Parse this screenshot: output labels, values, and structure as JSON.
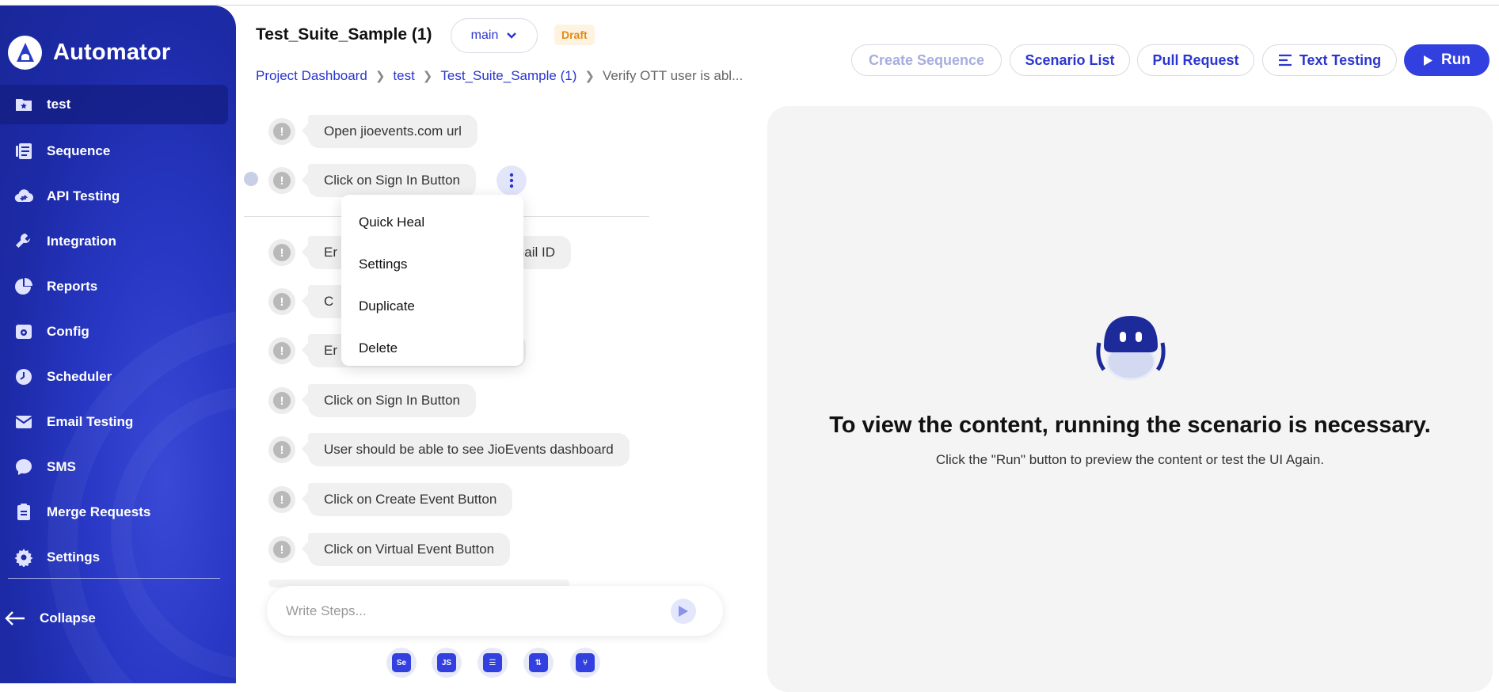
{
  "app": {
    "name": "Automator"
  },
  "sidebar": {
    "items": [
      {
        "label": "test",
        "icon": "folder-star-icon",
        "active": true
      },
      {
        "label": "Sequence",
        "icon": "sequence-icon"
      },
      {
        "label": "API Testing",
        "icon": "cloud-sync-icon"
      },
      {
        "label": "Integration",
        "icon": "wrench-icon"
      },
      {
        "label": "Reports",
        "icon": "pie-chart-icon"
      },
      {
        "label": "Config",
        "icon": "config-icon"
      },
      {
        "label": "Scheduler",
        "icon": "clock-icon"
      },
      {
        "label": "Email Testing",
        "icon": "mail-icon"
      },
      {
        "label": "SMS",
        "icon": "chat-bubble-icon"
      },
      {
        "label": "Merge Requests",
        "icon": "clipboard-icon"
      },
      {
        "label": "Settings",
        "icon": "gear-icon"
      }
    ],
    "collapse_label": "Collapse"
  },
  "header": {
    "title": "Test_Suite_Sample (1)",
    "branch": "main",
    "status_badge": "Draft",
    "breadcrumb": [
      "Project Dashboard",
      "test",
      "Test_Suite_Sample (1)",
      "Verify OTT user is abl..."
    ],
    "buttons": {
      "create_sequence": "Create Sequence",
      "scenario_list": "Scenario List",
      "pull_request": "Pull Request",
      "text_testing": "Text Testing",
      "run": "Run"
    }
  },
  "steps": [
    "Open jioevents.com url",
    "Click on Sign In Button",
    "Enter Email ID",
    "C",
    "Er",
    "Click on Sign In Button",
    "User should be able to see JioEvents dashboard",
    "Click on Create Event Button",
    "Click on Virtual Event Button"
  ],
  "step_partials": {
    "email_prefix": "Er",
    "email_suffix": "mail ID"
  },
  "context_menu": [
    "Quick Heal",
    "Settings",
    "Duplicate",
    "Delete"
  ],
  "composer": {
    "placeholder": "Write Steps..."
  },
  "toolbar_icons": [
    "selenium-icon",
    "javascript-icon",
    "list-add-icon",
    "cloud-upload-icon",
    "share-icon"
  ],
  "toolbar_labels": {
    "selenium": "Se",
    "javascript": "JS"
  },
  "preview": {
    "title": "To view the content, running the scenario is necessary.",
    "subtitle": "Click the \"Run\" button to preview the content or test the UI Again."
  },
  "colors": {
    "accent": "#3240e0",
    "draft": "#e38b17",
    "sidebar": "#2838c4"
  }
}
